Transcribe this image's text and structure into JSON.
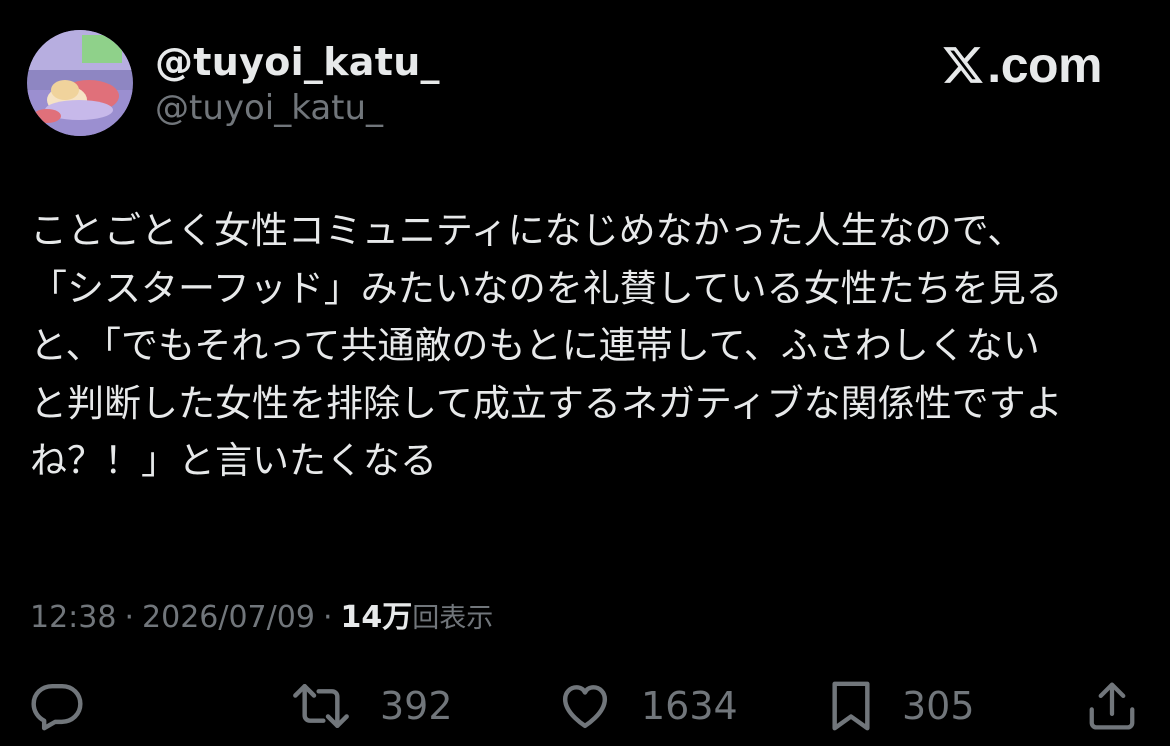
{
  "author": {
    "display_name": "@tuyoi_katu_",
    "handle": "@tuyoi_katu_",
    "avatar": "anime-girl-sleeping-avatar"
  },
  "brand": {
    "domain": ".com",
    "logo_icon": "x-logo-icon"
  },
  "tweet": {
    "lines": [
      "ことごとく女性コミュニティになじめなかった人生なので、",
      "「シスターフッド」みたいなのを礼賛している女性たちを見る",
      "と、「でもそれって共通敵のもとに連帯して、ふさわしくない",
      "と判断した女性を排除して成立するネガティブな関係性ですよ",
      "ね？！」と言いたくなる"
    ]
  },
  "meta": {
    "time": "12:38",
    "separator": "·",
    "date": "2026/07/09",
    "views_count": "14万",
    "views_label": "回表示"
  },
  "actions": {
    "reply": {
      "icon": "reply-icon"
    },
    "retweet": {
      "icon": "retweet-icon",
      "count": "392"
    },
    "like": {
      "icon": "heart-icon",
      "count": "1634"
    },
    "bookmark": {
      "icon": "bookmark-icon",
      "count": "305"
    },
    "share": {
      "icon": "share-icon"
    }
  },
  "colors": {
    "background": "#000000",
    "primary_text": "#e7e9ea",
    "secondary_text": "#71767b"
  }
}
